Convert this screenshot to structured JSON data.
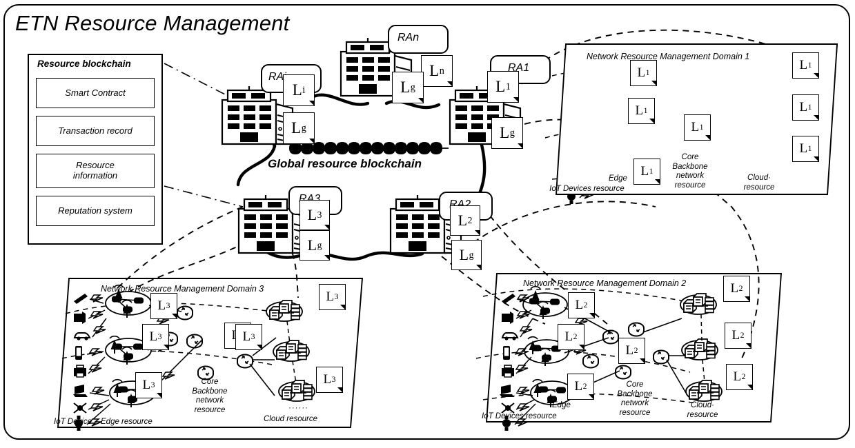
{
  "figure": {
    "title": "ETN Resource Management",
    "global_chain_label": "Global resource blockchain",
    "chain_block_count": 13
  },
  "resource_blockchain": {
    "panel_title": "Resource blockchain",
    "items": [
      {
        "label": "Smart Contract"
      },
      {
        "label": "Transaction record"
      },
      {
        "label": "Resource\ninformation"
      },
      {
        "label": "Reputation system"
      }
    ]
  },
  "resource_agents": [
    {
      "id": "rai",
      "name": "RAi",
      "local_ledger": "L",
      "local_sub": "i",
      "global_ledger": "L",
      "global_sub": "g"
    },
    {
      "id": "ran",
      "name": "RAn",
      "local_ledger": "L",
      "local_sub": "n",
      "global_ledger": "L",
      "global_sub": "g"
    },
    {
      "id": "ra1",
      "name": "RA1",
      "local_ledger": "L",
      "local_sub": "1",
      "global_ledger": "L",
      "global_sub": "g"
    },
    {
      "id": "ra3",
      "name": "RA3",
      "local_ledger": "L",
      "local_sub": "3",
      "global_ledger": "L",
      "global_sub": "g"
    },
    {
      "id": "ra2",
      "name": "RA2",
      "local_ledger": "L",
      "local_sub": "2",
      "global_ledger": "L",
      "global_sub": "g"
    }
  ],
  "domains": [
    {
      "id": "d1",
      "title": "Network Resource Management Domain 1",
      "ledger": "L",
      "ledger_sub": "1",
      "ledger_count": 7,
      "captions": {
        "iot": "IoT Devices resource",
        "edge": "Edge",
        "core": "Core\nBackbone\nnetwork\nresource",
        "cloud": "Cloud·\nresource"
      }
    },
    {
      "id": "d3",
      "title": "Network Resource Management Domain 3",
      "ledger": "L",
      "ledger_sub": "3",
      "ledger_count": 7,
      "captions": {
        "iot": "IoT Device",
        "edge": "Edge resource",
        "core": "Core\nBackbone\nnetwork\nresource",
        "cloud": "Cloud resource",
        "ellipsis": "······"
      }
    },
    {
      "id": "d2",
      "title": "Network Resource Management Domain 2",
      "ledger": "L",
      "ledger_sub": "2",
      "ledger_count": 7,
      "captions": {
        "iot": "IoT Devices resource",
        "edge": "Edge",
        "core": "Core\nBackbone\nnetwork\nresource",
        "cloud": "Cloud·\nresource"
      }
    }
  ],
  "colors": {
    "ink": "#000000",
    "paper": "#ffffff"
  }
}
